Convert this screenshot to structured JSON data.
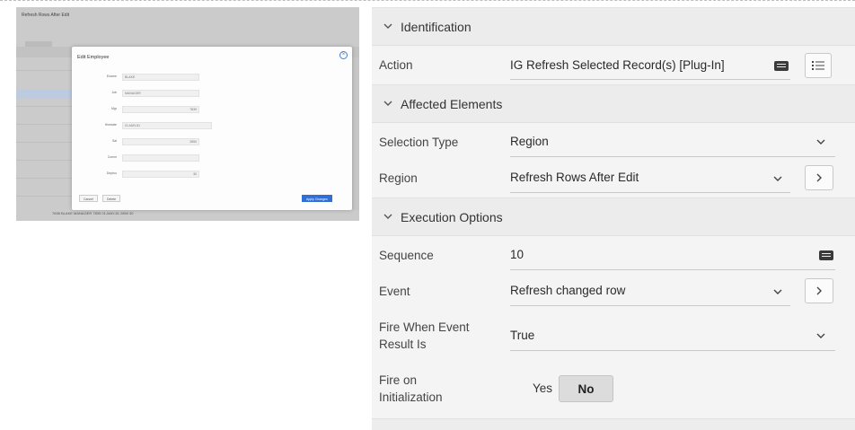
{
  "thumbnail": {
    "title": "Refresh Rows After Edit",
    "modal": {
      "title": "Edit Employee",
      "fields": [
        {
          "label": "Ename",
          "value": "BLAKE"
        },
        {
          "label": "Job",
          "value": "MANAGER"
        },
        {
          "label": "Mgr",
          "value": "7839"
        },
        {
          "label": "Hiredate",
          "value": "01-MAY-81"
        },
        {
          "label": "Sal",
          "value": "2850"
        },
        {
          "label": "Comm",
          "value": ""
        },
        {
          "label": "Deptno",
          "value": "30"
        }
      ],
      "cancel_label": "Cancel",
      "delete_label": "Delete",
      "apply_label": "Apply Changes"
    },
    "footer_row": "7698   BLAKE   MANAGER   7839   01-MAY-81   2850   30"
  },
  "sections": {
    "identification": "Identification",
    "affected": "Affected Elements",
    "execution": "Execution Options"
  },
  "props": {
    "action": {
      "label": "Action",
      "value": "IG Refresh Selected Record(s) [Plug-In]"
    },
    "selection_type": {
      "label": "Selection Type",
      "value": "Region"
    },
    "region": {
      "label": "Region",
      "value": "Refresh Rows After Edit"
    },
    "sequence": {
      "label": "Sequence",
      "value": "10"
    },
    "event": {
      "label": "Event",
      "value": "Refresh changed row"
    },
    "fire_when_1": "Fire When Event",
    "fire_when_2": "Result Is",
    "fire_when_value": "True",
    "fire_init_1": "Fire on",
    "fire_init_2": "Initialization",
    "fire_init_yes": "Yes",
    "fire_init_no": "No"
  },
  "icons": {
    "chevron": "chevron-down-icon",
    "forward": "chevron-right-icon",
    "list": "list-icon",
    "badge": "quick-pick-badge-icon"
  }
}
